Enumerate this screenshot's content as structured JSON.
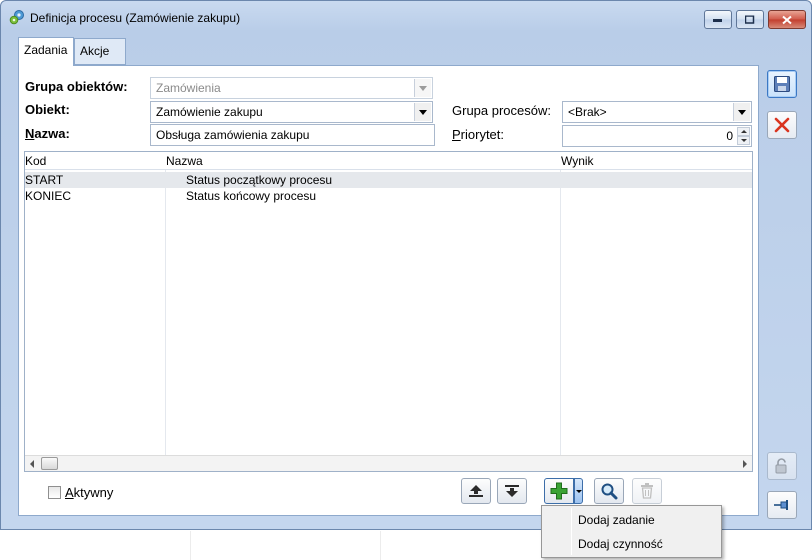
{
  "window": {
    "title": "Definicja procesu (Zamówienie zakupu)"
  },
  "tabs": [
    {
      "label": "Zadania",
      "active": true
    },
    {
      "label": "Akcje",
      "active": false
    }
  ],
  "form": {
    "grupa_obiektow_label": "Grupa obiektów:",
    "grupa_obiektow_value": "Zamówienia",
    "obiekt_label": "Obiekt:",
    "obiekt_value": "Zamówienie zakupu",
    "nazwa_label_first": "N",
    "nazwa_label_rest": "azwa:",
    "nazwa_value": "Obsługa zamówienia zakupu",
    "grupa_procesow_label": "Grupa procesów:",
    "grupa_procesow_value": "<Brak>",
    "priorytet_label_first": "P",
    "priorytet_label_rest": "riorytet:",
    "priorytet_value": "0"
  },
  "grid": {
    "columns": [
      "Kod",
      "Nazwa",
      "Wynik"
    ],
    "rows": [
      {
        "kod": "START",
        "nazwa": "Status początkowy procesu",
        "wynik": "",
        "selected": true
      },
      {
        "kod": "KONIEC",
        "nazwa": "Status końcowy procesu",
        "wynik": "",
        "selected": false
      }
    ]
  },
  "footer": {
    "aktywny_first": "A",
    "aktywny_rest": "ktywny",
    "aktywny_checked": false
  },
  "menu": {
    "items": [
      "Dodaj zadanie",
      "Dodaj czynność"
    ]
  },
  "colors": {
    "accent": "#3b78c4",
    "add_green": "#3aa335",
    "cancel_red": "#d9341f"
  },
  "icons": {
    "toolbar": [
      "move-up-icon",
      "move-down-icon",
      "add-icon",
      "magnifier-icon",
      "trash-icon"
    ],
    "side": [
      "save-icon",
      "cancel-icon",
      "unlock-icon",
      "pin-icon"
    ]
  }
}
